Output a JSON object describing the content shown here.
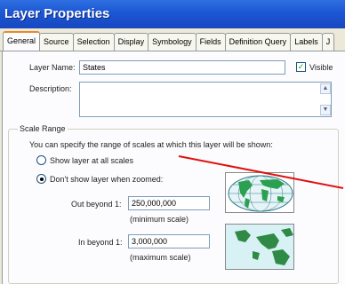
{
  "window": {
    "title": "Layer Properties"
  },
  "tabs": [
    {
      "label": "General",
      "active": true
    },
    {
      "label": "Source"
    },
    {
      "label": "Selection"
    },
    {
      "label": "Display"
    },
    {
      "label": "Symbology"
    },
    {
      "label": "Fields"
    },
    {
      "label": "Definition Query"
    },
    {
      "label": "Labels"
    },
    {
      "label": "J"
    }
  ],
  "general": {
    "layer_name_label": "Layer Name:",
    "layer_name_value": "States",
    "visible_label": "Visible",
    "visible_checked": true,
    "description_label": "Description:"
  },
  "scale_range": {
    "legend": "Scale Range",
    "info": "You can specify the range of scales at which this layer will be shown:",
    "option_all": "Show layer at all scales",
    "option_zoomed": "Don't show layer when zoomed:",
    "selected": "option_zoomed",
    "out_beyond_label": "Out beyond 1:",
    "out_beyond_value": "250,000,000",
    "out_beyond_hint": "(minimum scale)",
    "in_beyond_label": "In beyond 1:",
    "in_beyond_value": "3,000,000",
    "in_beyond_hint": "(maximum scale)"
  },
  "colors": {
    "title_bar": "#1c56d4",
    "active_tab_accent": "#e68b2c",
    "annotation_line": "#e01010"
  }
}
